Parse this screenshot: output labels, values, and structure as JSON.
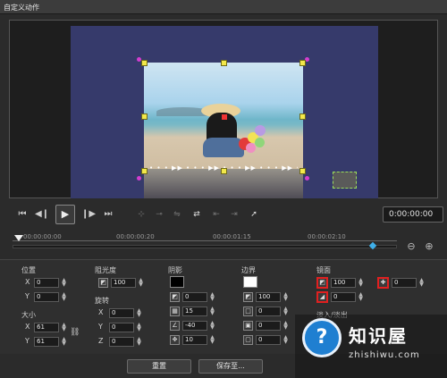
{
  "window": {
    "title": "自定义动作"
  },
  "overlay": {
    "dot_text": "• • • ▶▶ • • • ▶▶ • • • ▶▶ • • • ▶▶ • • •"
  },
  "playback": {
    "timecode": "0:00:00:00",
    "icons": [
      "skip-start-icon",
      "prev-frame-icon",
      "play-icon",
      "next-frame-icon",
      "skip-end-icon"
    ]
  },
  "timeline": {
    "labels": [
      "00:00:00:00",
      "00:00:00:20",
      "00:00:01:15",
      "00:00:02:10"
    ]
  },
  "position": {
    "label": "位置",
    "x_label": "X",
    "x_value": "0",
    "y_label": "Y",
    "y_value": "0"
  },
  "size": {
    "label": "大小",
    "x_label": "X",
    "x_value": "61",
    "y_label": "Y",
    "y_value": "61"
  },
  "opacity": {
    "label": "阻光度",
    "value": "100"
  },
  "rotation": {
    "label": "旋转",
    "x_label": "X",
    "x_value": "0",
    "y_label": "Y",
    "y_value": "0",
    "z_label": "Z",
    "z_value": "0"
  },
  "shadow": {
    "label": "阴影",
    "color": "#000000",
    "opacity_value": "0",
    "blur_value": "15",
    "angle_value": "-40",
    "distance_value": "10"
  },
  "border": {
    "label": "边界",
    "color": "#ffffff",
    "opacity_value": "100",
    "width_value": "0",
    "field3_value": "0",
    "field4_value": "0"
  },
  "mirror": {
    "label": "镜面",
    "opacity_value": "100",
    "fade_value": "0",
    "offset_value": "0"
  },
  "fade": {
    "label": "淡入/淡出"
  },
  "buttons": {
    "reset": "重置",
    "save_to": "保存至..."
  },
  "watermark": {
    "title": "知识屋",
    "url": "zhishiwu.com",
    "logo_glyph": "?"
  }
}
